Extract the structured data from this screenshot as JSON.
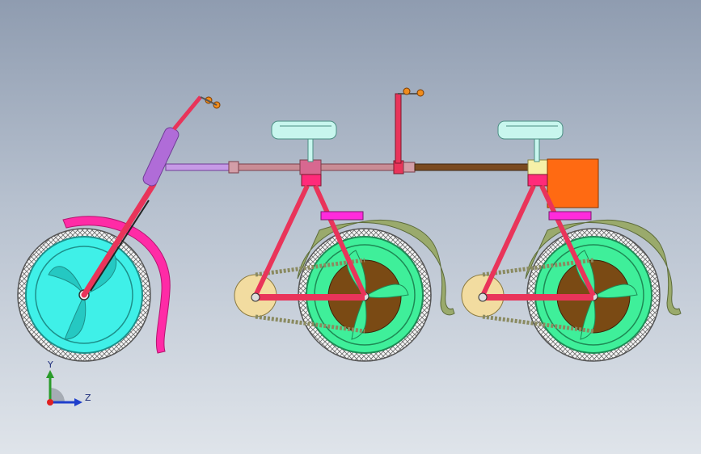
{
  "triad": {
    "y_label": "Y",
    "z_label": "Z"
  },
  "colors": {
    "front_wheel": "#3ff0e8",
    "rear_wheel": "#3fef9a",
    "frame_red": "#e9345a",
    "fender_pink": "#ff2ba6",
    "fender_olive": "#9aaa6c",
    "seat": "#c8f6ee",
    "brown_hub": "#7a4a14",
    "motor_box": "#ff6a12",
    "fork_purple": "#b06cd8",
    "axis_y": "#2a9b2a",
    "axis_z": "#1f3fcc"
  }
}
